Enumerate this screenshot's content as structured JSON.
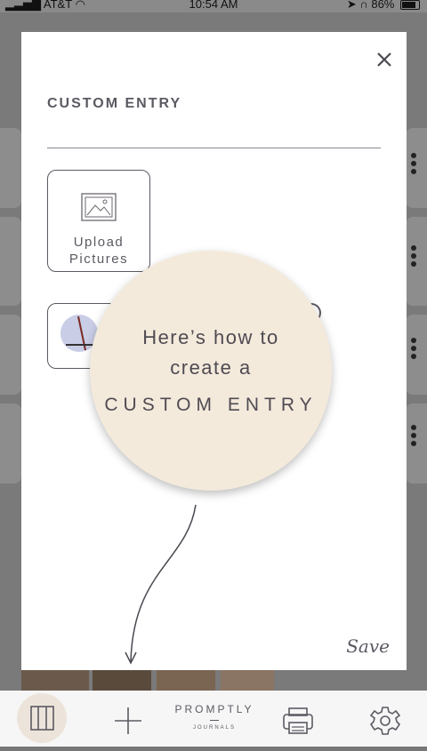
{
  "status_bar": {
    "carrier": "AT&T",
    "time": "10:54 AM",
    "battery": "86%",
    "battery_level": 0.86
  },
  "modal": {
    "title": "CUSTOM ENTRY",
    "close_icon": "close-icon",
    "upload_tile": {
      "icon": "picture-icon",
      "label_line1": "Upload",
      "label_line2": "Pictures"
    },
    "save_label": "Save"
  },
  "coachmark": {
    "line1": "Here’s how to",
    "line2": "create a",
    "line3": "CUSTOM ENTRY"
  },
  "tabbar": {
    "items": [
      {
        "icon": "columns-icon"
      },
      {
        "icon": "plus-icon"
      },
      {
        "icon": "print-icon"
      },
      {
        "icon": "gear-icon"
      }
    ],
    "brand_top": "PROMPTLY",
    "brand_bottom": "JOURNALS"
  },
  "colors": {
    "accent": "#5b5a63",
    "coach_bg": "#f3eadc",
    "active_tab_bg": "#ece4da"
  }
}
